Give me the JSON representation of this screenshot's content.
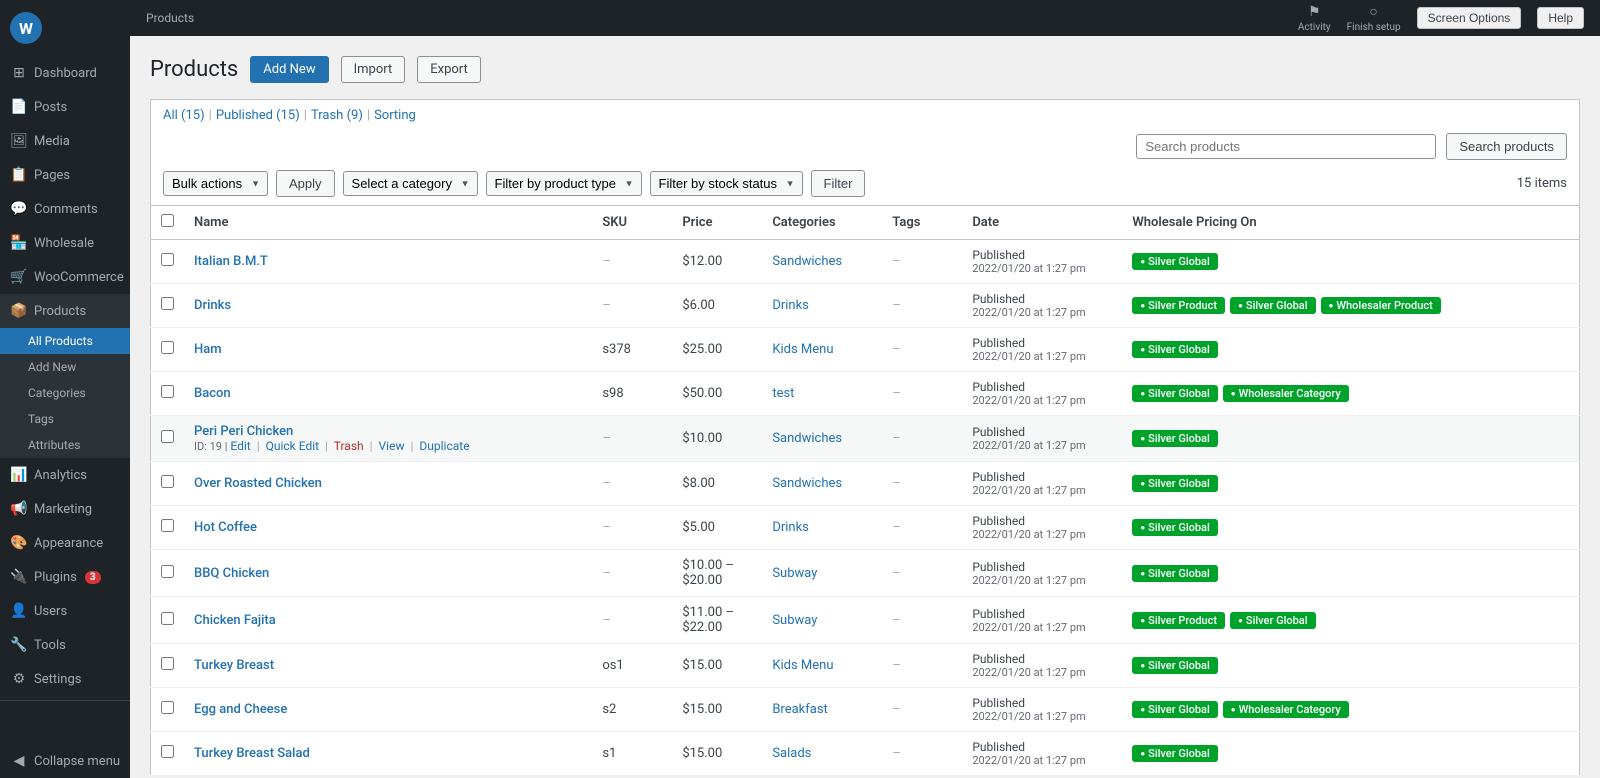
{
  "topbar": {
    "title": "Products",
    "activity_label": "Activity",
    "finish_setup_label": "Finish setup",
    "screen_options_label": "Screen Options",
    "help_label": "Help"
  },
  "sidebar": {
    "logo_letter": "W",
    "items": [
      {
        "id": "dashboard",
        "label": "Dashboard",
        "icon": "⊞"
      },
      {
        "id": "posts",
        "label": "Posts",
        "icon": "📄"
      },
      {
        "id": "media",
        "label": "Media",
        "icon": "🖼"
      },
      {
        "id": "pages",
        "label": "Pages",
        "icon": "📋"
      },
      {
        "id": "comments",
        "label": "Comments",
        "icon": "💬"
      },
      {
        "id": "wholesale",
        "label": "Wholesale",
        "icon": "🏪"
      },
      {
        "id": "woocommerce",
        "label": "WooCommerce",
        "icon": "🛒"
      },
      {
        "id": "products",
        "label": "Products",
        "icon": "📦",
        "active": true
      }
    ],
    "sub_items": [
      {
        "id": "all-products",
        "label": "All Products",
        "active": true
      },
      {
        "id": "add-new",
        "label": "Add New"
      },
      {
        "id": "categories",
        "label": "Categories"
      },
      {
        "id": "tags",
        "label": "Tags"
      },
      {
        "id": "attributes",
        "label": "Attributes"
      }
    ],
    "bottom_items": [
      {
        "id": "analytics",
        "label": "Analytics",
        "icon": "📊"
      },
      {
        "id": "marketing",
        "label": "Marketing",
        "icon": "📢"
      },
      {
        "id": "appearance",
        "label": "Appearance",
        "icon": "🎨"
      },
      {
        "id": "plugins",
        "label": "Plugins",
        "icon": "🔌",
        "badge": "3"
      },
      {
        "id": "users",
        "label": "Users",
        "icon": "👤"
      },
      {
        "id": "tools",
        "label": "Tools",
        "icon": "🔧"
      },
      {
        "id": "settings",
        "label": "Settings",
        "icon": "⚙"
      }
    ],
    "collapse_label": "Collapse menu"
  },
  "page": {
    "title": "Products",
    "add_new": "Add New",
    "import": "Import",
    "export": "Export"
  },
  "subnav": {
    "all_label": "All",
    "all_count": "15",
    "published_label": "Published",
    "published_count": "15",
    "trash_label": "Trash",
    "trash_count": "9",
    "sorting_label": "Sorting"
  },
  "search": {
    "placeholder": "Search products",
    "button": "Search products"
  },
  "filters": {
    "bulk_actions": "Bulk actions",
    "apply": "Apply",
    "select_category": "Select a category",
    "filter_type": "Filter by product type",
    "filter_stock": "Filter by stock status",
    "filter_btn": "Filter",
    "item_count": "15 items"
  },
  "table": {
    "headers": [
      "",
      "Name",
      "SKU",
      "Price",
      "Categories",
      "Tags",
      "Date",
      "Wholesale Pricing On"
    ],
    "rows": [
      {
        "name": "Italian B.M.T",
        "sku": "–",
        "price": "$12.00",
        "category": "Sandwiches",
        "category_link": true,
        "tags": "–",
        "status": "Published",
        "date": "2022/01/20 at 1:27 pm",
        "badges": [
          "Silver Global"
        ]
      },
      {
        "name": "Drinks",
        "sku": "–",
        "price": "$6.00",
        "category": "Drinks",
        "category_link": true,
        "tags": "–",
        "status": "Published",
        "date": "2022/01/20 at 1:27 pm",
        "badges": [
          "Silver Product",
          "Silver Global",
          "Wholesaler Product"
        ]
      },
      {
        "name": "Ham",
        "sku": "s378",
        "price": "$25.00",
        "category": "Kids Menu",
        "category_link": true,
        "tags": "–",
        "status": "Published",
        "date": "2022/01/20 at 1:27 pm",
        "badges": [
          "Silver Global"
        ]
      },
      {
        "name": "Bacon",
        "sku": "s98",
        "price": "$50.00",
        "category": "test",
        "category_link": true,
        "tags": "–",
        "status": "Published",
        "date": "2022/01/20 at 1:27 pm",
        "badges": [
          "Silver Global",
          "Wholesaler Category"
        ]
      },
      {
        "name": "Peri Peri Chicken",
        "sku": "–",
        "price": "$10.00",
        "category": "Sandwiches",
        "category_link": true,
        "tags": "–",
        "status": "Published",
        "date": "2022/01/20 at 1:27 pm",
        "badges": [
          "Silver Global"
        ],
        "row_actions": true,
        "row_id": "19"
      },
      {
        "name": "Over Roasted Chicken",
        "sku": "–",
        "price": "$8.00",
        "category": "Sandwiches",
        "category_link": true,
        "tags": "–",
        "status": "Published",
        "date": "2022/01/20 at 1:27 pm",
        "badges": [
          "Silver Global"
        ]
      },
      {
        "name": "Hot Coffee",
        "sku": "–",
        "price": "$5.00",
        "category": "Drinks",
        "category_link": true,
        "tags": "–",
        "status": "Published",
        "date": "2022/01/20 at 1:27 pm",
        "badges": [
          "Silver Global"
        ]
      },
      {
        "name": "BBQ Chicken",
        "sku": "–",
        "price": "$10.00 – $20.00",
        "category": "Subway",
        "category_link": true,
        "tags": "–",
        "status": "Published",
        "date": "2022/01/20 at 1:27 pm",
        "badges": [
          "Silver Global"
        ]
      },
      {
        "name": "Chicken Fajita",
        "sku": "–",
        "price": "$11.00 – $22.00",
        "category": "Subway",
        "category_link": true,
        "tags": "–",
        "status": "Published",
        "date": "2022/01/20 at 1:27 pm",
        "badges": [
          "Silver Product",
          "Silver Global"
        ]
      },
      {
        "name": "Turkey Breast",
        "sku": "os1",
        "price": "$15.00",
        "category": "Kids Menu",
        "category_link": true,
        "tags": "–",
        "status": "Published",
        "date": "2022/01/20 at 1:27 pm",
        "badges": [
          "Silver Global"
        ]
      },
      {
        "name": "Egg and Cheese",
        "sku": "s2",
        "price": "$15.00",
        "category": "Breakfast",
        "category_link": true,
        "tags": "–",
        "status": "Published",
        "date": "2022/01/20 at 1:27 pm",
        "badges": [
          "Silver Global",
          "Wholesaler Category"
        ]
      },
      {
        "name": "Turkey Breast Salad",
        "sku": "s1",
        "price": "$15.00",
        "category": "Salads",
        "category_link": true,
        "tags": "–",
        "status": "Published",
        "date": "2022/01/20 at 1:27 pm",
        "badges": [
          "Silver Global"
        ]
      }
    ],
    "row_actions": {
      "edit": "Edit",
      "quick_edit": "Quick Edit",
      "trash": "Trash",
      "view": "View",
      "duplicate": "Duplicate"
    }
  }
}
